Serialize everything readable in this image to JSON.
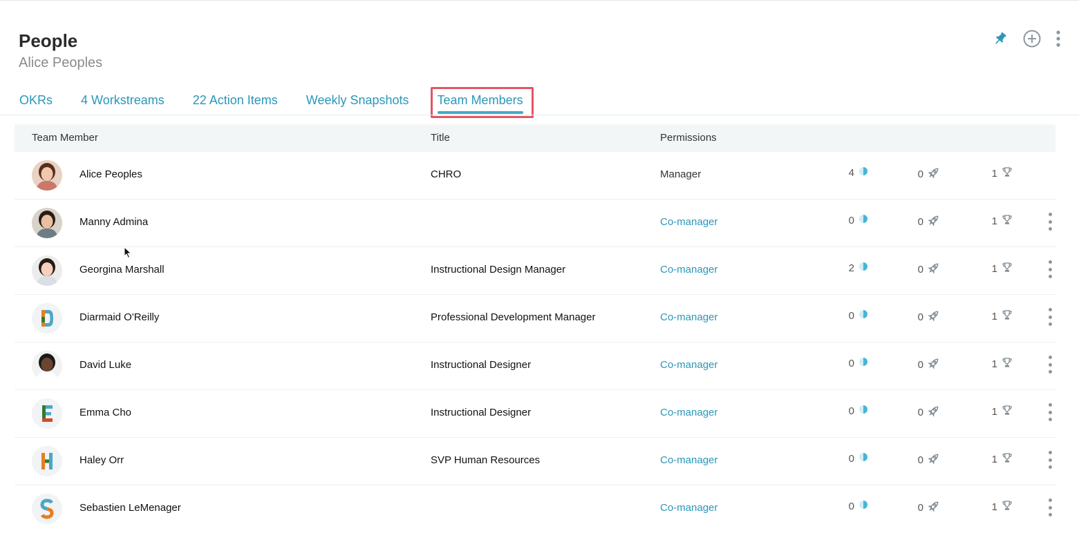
{
  "page": {
    "title": "People",
    "subtitle": "Alice Peoples"
  },
  "header_actions": [
    "pin-icon",
    "add-circle-icon",
    "more-vertical-icon"
  ],
  "tabs": [
    {
      "label": "OKRs",
      "active": false
    },
    {
      "label": "4 Workstreams",
      "active": false
    },
    {
      "label": "22 Action Items",
      "active": false
    },
    {
      "label": "Weekly Snapshots",
      "active": false
    },
    {
      "label": "Team Members",
      "active": true
    }
  ],
  "table": {
    "columns": [
      "Team Member",
      "Title",
      "Permissions"
    ],
    "stat_icons": [
      "progress-half-circle-icon",
      "rocket-icon",
      "trophy-icon"
    ],
    "rows": [
      {
        "name": "Alice Peoples",
        "title": "CHRO",
        "permission": "Manager",
        "stats": [
          "4",
          "0",
          "1"
        ],
        "avatar": "photo"
      },
      {
        "name": "Manny Admina",
        "title": "",
        "permission": "Co-manager",
        "stats": [
          "0",
          "0",
          "1"
        ],
        "avatar": "photo"
      },
      {
        "name": "Georgina Marshall",
        "title": "Instructional Design Manager",
        "permission": "Co-manager",
        "stats": [
          "2",
          "0",
          "1"
        ],
        "avatar": "photo"
      },
      {
        "name": "Diarmaid O'Reilly",
        "title": "Professional Development Manager",
        "permission": "Co-manager",
        "stats": [
          "0",
          "0",
          "1"
        ],
        "avatar": "D"
      },
      {
        "name": "David Luke",
        "title": "Instructional Designer",
        "permission": "Co-manager",
        "stats": [
          "0",
          "0",
          "1"
        ],
        "avatar": "photo"
      },
      {
        "name": "Emma Cho",
        "title": "Instructional Designer",
        "permission": "Co-manager",
        "stats": [
          "0",
          "0",
          "1"
        ],
        "avatar": "E"
      },
      {
        "name": "Haley Orr",
        "title": "SVP Human Resources",
        "permission": "Co-manager",
        "stats": [
          "0",
          "0",
          "1"
        ],
        "avatar": "H"
      },
      {
        "name": "Sebastien LeMenager",
        "title": "",
        "permission": "Co-manager",
        "stats": [
          "0",
          "0",
          "1"
        ],
        "avatar": "S"
      }
    ]
  },
  "colors": {
    "accent": "#2a97b8",
    "highlight": "#e55463",
    "header_bg": "#f3f6f7"
  }
}
